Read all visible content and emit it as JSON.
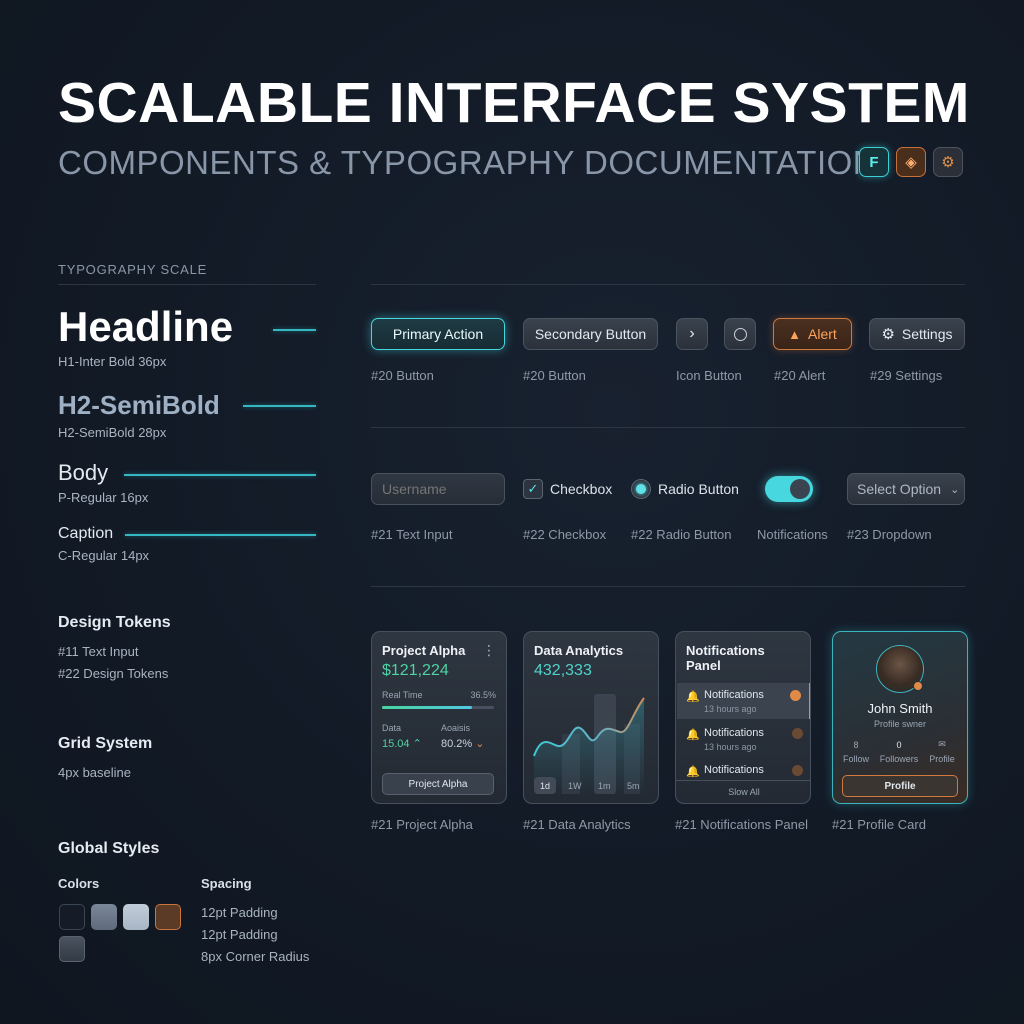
{
  "header": {
    "title": "SCALABLE INTERFACE SYSTEM",
    "subtitle": "COMPONENTS & TYPOGRAPHY DOCUMENTATION",
    "icons": [
      "figma-icon",
      "layers-icon",
      "gear-icon"
    ]
  },
  "typography": {
    "section_label": "TYPOGRAPHY SCALE",
    "h1": {
      "sample": "Headline",
      "spec": "H1-Inter Bold 36px"
    },
    "h2": {
      "sample": "H2-SemiBold",
      "spec": "H2-SemiBold 28px"
    },
    "body": {
      "sample": "Body",
      "spec": "P-Regular 16px"
    },
    "caption": {
      "sample": "Caption",
      "spec": "C-Regular 14px"
    }
  },
  "design_tokens": {
    "heading": "Design Tokens",
    "items": [
      "#11 Text Input",
      "#22 Design Tokens"
    ]
  },
  "grid_system": {
    "heading": "Grid System",
    "items": [
      "4px baseline"
    ]
  },
  "global_styles": {
    "heading": "Global Styles",
    "colors_label": "Colors",
    "swatches": [
      "#151c28",
      "#6f7c8c",
      "#b6c3d1",
      "#5b3a26",
      "#3a434e"
    ],
    "spacing_label": "Spacing",
    "spacing_items": [
      "12pt Padding",
      "12pt Padding",
      "8px Corner Radius"
    ]
  },
  "buttons_row": {
    "primary": "Primary Action",
    "secondary": "Secondary Button",
    "alert": "Alert",
    "settings": "Settings",
    "captions": [
      "#20 Button",
      "#20 Button",
      "Icon Button",
      "#20 Alert",
      "#29 Settings"
    ]
  },
  "inputs_row": {
    "input_placeholder": "Username",
    "checkbox": "Checkbox",
    "radio": "Radio Button",
    "dropdown": "Select Option",
    "captions": [
      "#21 Text Input",
      "#22 Checkbox",
      "#22 Radio Button",
      "Notifications",
      "#23 Dropdown"
    ]
  },
  "cards": {
    "project": {
      "title": "Project Alpha",
      "value": "$121,224",
      "progress_label": "Real Time",
      "progress_value": "36.5%",
      "progress_fraction": 0.8,
      "data_label": "Data",
      "data_value": "15.04",
      "analysis_label": "Aoaisis",
      "analysis_value": "80.2%",
      "button": "Project Alpha"
    },
    "analytics": {
      "title": "Data Analytics",
      "value": "432,333",
      "ranges": [
        "1d",
        "1W",
        "1m",
        "5m"
      ]
    },
    "notifications": {
      "title_line1": "Notifications",
      "title_line2": "Panel",
      "items": [
        {
          "title": "Notifications",
          "time": "13 hours ago"
        },
        {
          "title": "Notifications",
          "time": "13 hours ago"
        },
        {
          "title": "Notifications",
          "time": ""
        }
      ],
      "footer": "Slow All"
    },
    "profile": {
      "name": "John Smith",
      "role": "Profile swner",
      "stats": [
        {
          "icon": "people-icon",
          "value": "8",
          "label": "Follow"
        },
        {
          "icon": "",
          "value": "0",
          "label": "Followers"
        },
        {
          "icon": "mail-icon",
          "value": "",
          "label": "Profile"
        }
      ],
      "button": "Profile"
    },
    "captions": [
      "#21 Project Alpha",
      "#21 Data Analytics",
      "#21 Notifications Panel",
      "#21 Profile Card"
    ]
  },
  "colors": {
    "accent": "#46d6df",
    "warning": "#d1783d",
    "success": "#4fd3a4"
  }
}
